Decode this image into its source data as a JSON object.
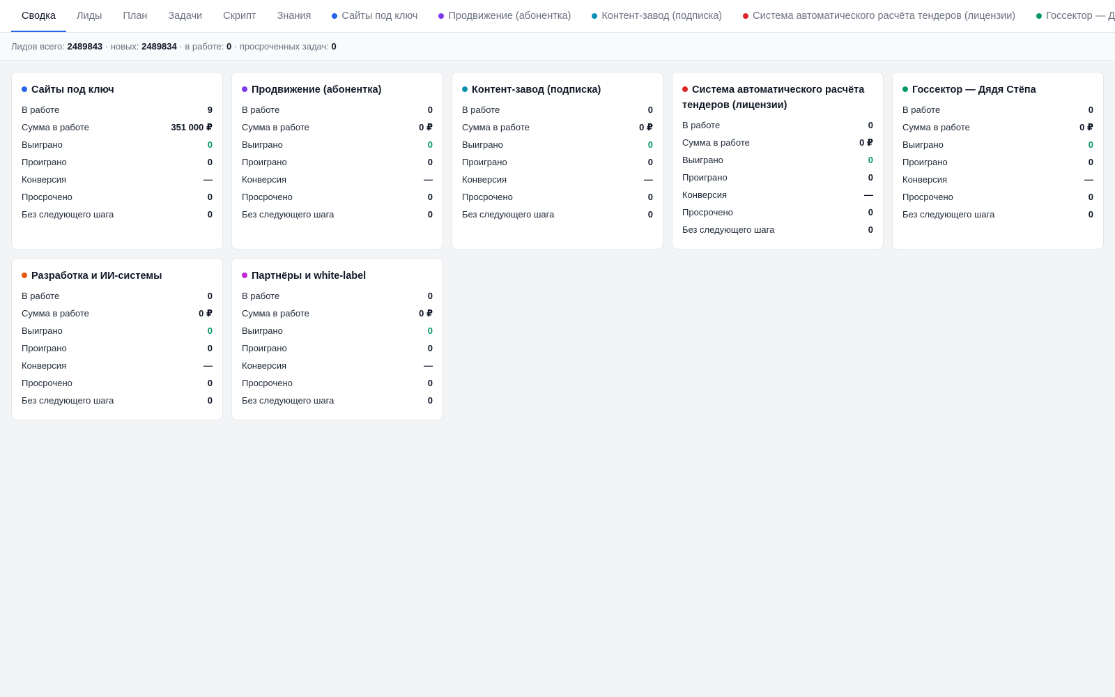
{
  "tabs": [
    {
      "label": "Сводка",
      "active": true
    },
    {
      "label": "Лиды"
    },
    {
      "label": "План"
    },
    {
      "label": "Задачи"
    },
    {
      "label": "Скрипт"
    },
    {
      "label": "Знания"
    },
    {
      "label": "Сайты под ключ",
      "color": "#2563eb"
    },
    {
      "label": "Продвижение (абонентка)",
      "color": "#7c3aed"
    },
    {
      "label": "Контент-завод (подписка)",
      "color": "#0891b2"
    },
    {
      "label": "Система автоматического расчёта тендеров (лицензии)",
      "color": "#dc2626"
    },
    {
      "label": "Госсектор — Дядя Стёпа",
      "color": "#059669"
    }
  ],
  "summary": {
    "total_label": "Лидов всего:",
    "total": "2489843",
    "new_label": "· новых:",
    "new": "2489834",
    "inwork_label": "· в работе:",
    "inwork": "0",
    "overdue_label": "· просроченных задач:",
    "overdue": "0"
  },
  "row_labels": [
    "В работе",
    "Сумма в работе",
    "Выиграно",
    "Проиграно",
    "Конверсия",
    "Просрочено",
    "Без следующего шага"
  ],
  "cards": [
    {
      "title": "Сайты под ключ",
      "color": "#2563eb",
      "values": [
        "9",
        "351 000 ₽",
        "0",
        "0",
        "—",
        "0",
        "0"
      ]
    },
    {
      "title": "Продвижение (абонентка)",
      "color": "#7c3aed",
      "values": [
        "0",
        "0 ₽",
        "0",
        "0",
        "—",
        "0",
        "0"
      ]
    },
    {
      "title": "Контент-завод (подписка)",
      "color": "#0891b2",
      "values": [
        "0",
        "0 ₽",
        "0",
        "0",
        "—",
        "0",
        "0"
      ]
    },
    {
      "title": "Система автоматического расчёта тендеров (лицензии)",
      "color": "#dc2626",
      "values": [
        "0",
        "0 ₽",
        "0",
        "0",
        "—",
        "0",
        "0"
      ]
    },
    {
      "title": "Госсектор — Дядя Стёпа",
      "color": "#059669",
      "values": [
        "0",
        "0 ₽",
        "0",
        "0",
        "—",
        "0",
        "0"
      ]
    },
    {
      "title": "Разработка и ИИ-системы",
      "color": "#ea580c",
      "values": [
        "0",
        "0 ₽",
        "0",
        "0",
        "—",
        "0",
        "0"
      ]
    },
    {
      "title": "Партнёры и white-label",
      "color": "#c026d3",
      "values": [
        "0",
        "0 ₽",
        "0",
        "0",
        "—",
        "0",
        "0"
      ]
    }
  ]
}
